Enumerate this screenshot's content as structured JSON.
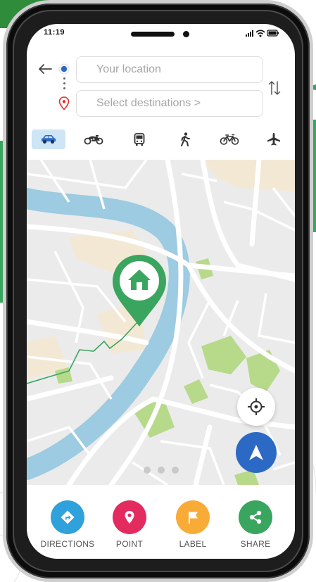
{
  "status_bar": {
    "time": "11:19"
  },
  "search": {
    "origin_placeholder": "Your location",
    "destination_placeholder": "Select destinations  >"
  },
  "transport_modes": [
    {
      "icon": "car-icon",
      "active": true
    },
    {
      "icon": "motorbike-icon",
      "active": false
    },
    {
      "icon": "bus-icon",
      "active": false
    },
    {
      "icon": "walking-icon",
      "active": false
    },
    {
      "icon": "bicycle-icon",
      "active": false
    },
    {
      "icon": "airplane-icon",
      "active": false
    }
  ],
  "map": {
    "marker_icon": "home-icon",
    "carousel_pages": 3
  },
  "actions": [
    {
      "label": "DIRECTIONS",
      "icon": "directions-icon",
      "color": "#2fa1db"
    },
    {
      "label": "POINT",
      "icon": "location-pin-icon",
      "color": "#e32b5f"
    },
    {
      "label": "LABEL",
      "icon": "flag-icon",
      "color": "#f9ab38"
    },
    {
      "label": "SHARE",
      "icon": "share-icon",
      "color": "#3aa55e"
    }
  ],
  "colors": {
    "brand_green": "#3aa55e",
    "accent_blue": "#2c69c4",
    "river": "#9ccbe2",
    "park": "#b7d98a"
  }
}
